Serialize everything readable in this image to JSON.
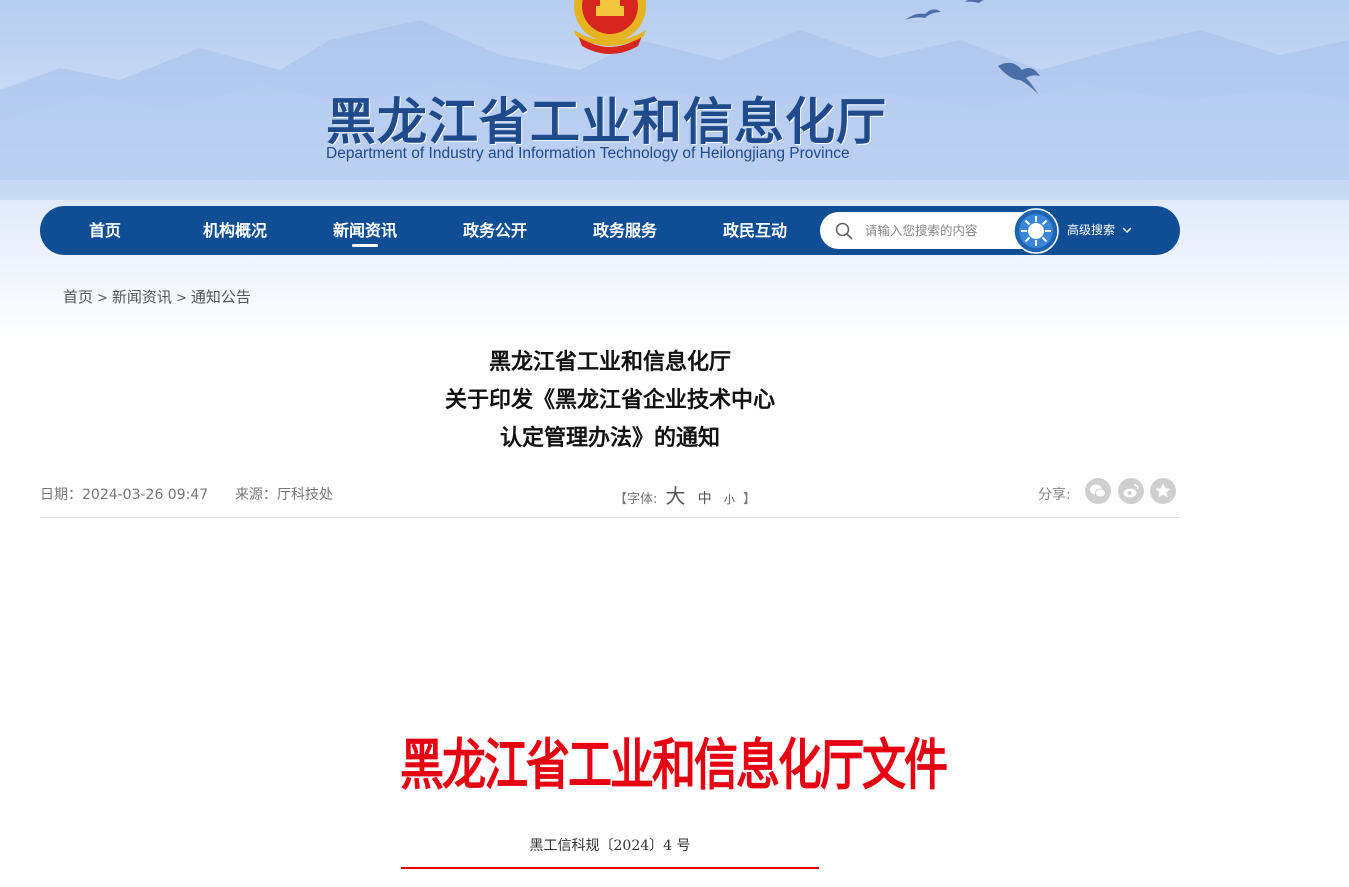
{
  "header": {
    "site_title": "黑龙江省工业和信息化厅",
    "site_subtitle": "Department of Industry and Information Technology of Heilongjiang Province"
  },
  "nav": {
    "items": [
      {
        "label": "首页",
        "active": false
      },
      {
        "label": "机构概况",
        "active": false
      },
      {
        "label": "新闻资讯",
        "active": true
      },
      {
        "label": "政务公开",
        "active": false
      },
      {
        "label": "政务服务",
        "active": false
      },
      {
        "label": "政民互动",
        "active": false
      }
    ],
    "search_placeholder": "请输入您搜索的内容",
    "advanced_search": "高级搜索"
  },
  "breadcrumb": {
    "items": [
      "首页",
      "新闻资讯",
      "通知公告"
    ],
    "separator": ">"
  },
  "article": {
    "title_lines": [
      "黑龙江省工业和信息化厅",
      "关于印发《黑龙江省企业技术中心",
      "认定管理办法》的通知"
    ],
    "date": "日期：2024-03-26 09:47",
    "source": "来源：厅科技处",
    "font_label_open": "【字体:",
    "font_large": "大",
    "font_medium": "中",
    "font_small": "小",
    "font_label_close": "】",
    "share_label": "分享:"
  },
  "document": {
    "header": "黑龙江省工业和信息化厅文件",
    "number": "黑工信科规〔2024〕4 号"
  },
  "colors": {
    "nav_bg": "#0f4d94",
    "title_blue": "#1f4a8c",
    "doc_red": "#e60012"
  }
}
